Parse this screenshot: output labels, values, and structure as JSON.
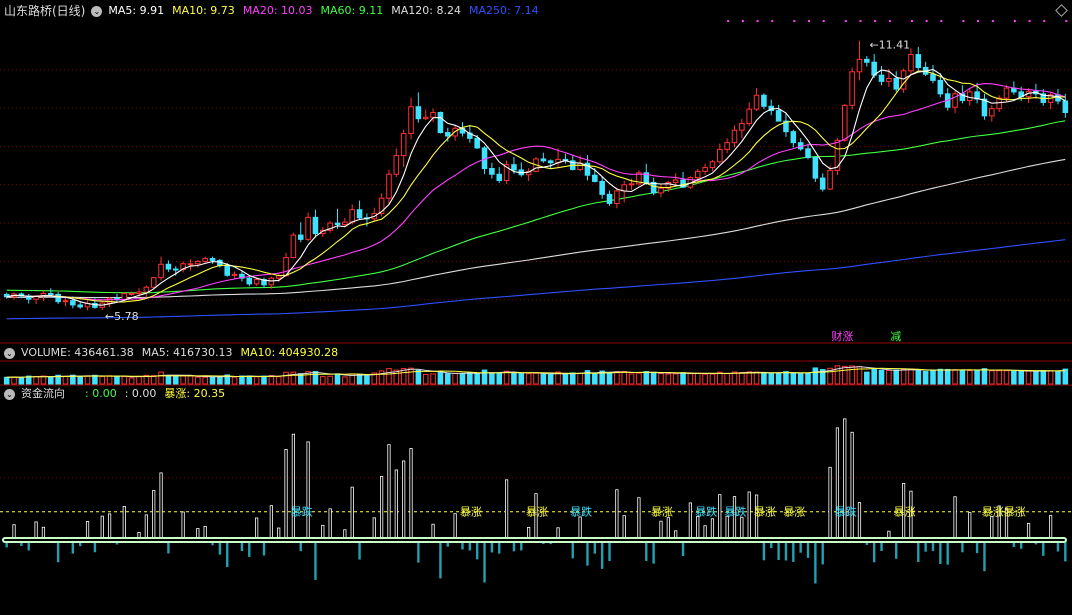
{
  "header": {
    "title": "山东路桥(日线)",
    "ma_items": [
      {
        "label": "MA5: 9.91",
        "color": "#ffffff"
      },
      {
        "label": "MA10: 9.73",
        "color": "#ffff40"
      },
      {
        "label": "MA20: 10.03",
        "color": "#ff40ff"
      },
      {
        "label": "MA60: 9.11",
        "color": "#40ff40"
      },
      {
        "label": "MA120: 8.24",
        "color": "#dddddd"
      },
      {
        "label": "MA250: 7.14",
        "color": "#3050ff"
      }
    ]
  },
  "volume_header": {
    "items": [
      {
        "label": "VOLUME: 436461.38",
        "color": "#dddddd"
      },
      {
        "label": "MA5: 416730.13",
        "color": "#dddddd"
      },
      {
        "label": "MA10: 404930.28",
        "color": "#ffff40"
      }
    ]
  },
  "flow_header": {
    "title": "资金流向",
    "items": [
      {
        "label": ": 0.00",
        "color": "#40ff40"
      },
      {
        "label": ": 0.00",
        "color": "#dddddd"
      },
      {
        "label": "暴涨: 20.35",
        "color": "#ffff40"
      }
    ]
  },
  "colors": {
    "up": "#ff3030",
    "down": "#40e0ff",
    "ma5": "#ffffff",
    "ma10": "#ffff40",
    "ma20": "#ff40ff",
    "ma60": "#40ff40",
    "ma120": "#dddddd",
    "ma250": "#3050ff",
    "grid": "#800000",
    "dot": "#ff40ff",
    "flow_down": "#20a0b0",
    "bao_zhang": "#ffff40",
    "bao_die": "#40e0ff"
  },
  "chart_data": [
    {
      "type": "candlestick",
      "ylim": [
        5.2,
        11.8
      ],
      "annotations": [
        {
          "text": "11.41",
          "index": 116,
          "value": 11.41
        },
        {
          "text": "5.78",
          "index": 12,
          "value": 5.78
        }
      ],
      "signals": [
        {
          "text": "财涨",
          "index": 113,
          "color": "#ff40ff"
        },
        {
          "text": "减",
          "index": 121,
          "color": "#40ff40"
        }
      ],
      "candles": [
        [
          6.11,
          6.15,
          6.02,
          6.06
        ],
        [
          6.06,
          6.15,
          6.0,
          6.12
        ],
        [
          6.12,
          6.15,
          6.03,
          6.08
        ],
        [
          6.08,
          6.12,
          5.92,
          6.01
        ],
        [
          6.01,
          6.09,
          5.91,
          6.08
        ],
        [
          6.08,
          6.18,
          5.97,
          6.13
        ],
        [
          6.13,
          6.24,
          6.1,
          6.11
        ],
        [
          6.11,
          6.16,
          5.91,
          5.96
        ],
        [
          5.96,
          6.05,
          5.86,
          5.98
        ],
        [
          5.98,
          6.07,
          5.82,
          5.89
        ],
        [
          5.89,
          5.96,
          5.81,
          5.85
        ],
        [
          5.85,
          5.99,
          5.78,
          5.92
        ],
        [
          5.92,
          6.05,
          5.81,
          5.84
        ],
        [
          5.84,
          5.96,
          5.79,
          5.93
        ],
        [
          5.93,
          6.06,
          5.84,
          6.03
        ],
        [
          6.03,
          6.12,
          5.95,
          6.0
        ],
        [
          6.0,
          6.15,
          5.97,
          6.13
        ],
        [
          6.13,
          6.17,
          6.08,
          6.13
        ],
        [
          6.13,
          6.24,
          6.05,
          6.16
        ],
        [
          6.16,
          6.3,
          6.05,
          6.26
        ],
        [
          6.26,
          6.48,
          6.24,
          6.46
        ],
        [
          6.46,
          6.9,
          6.4,
          6.74
        ],
        [
          6.74,
          6.82,
          6.58,
          6.64
        ],
        [
          6.64,
          6.7,
          6.5,
          6.63
        ],
        [
          6.63,
          6.8,
          6.57,
          6.75
        ],
        [
          6.75,
          6.84,
          6.61,
          6.75
        ],
        [
          6.75,
          6.83,
          6.67,
          6.8
        ],
        [
          6.8,
          6.9,
          6.75,
          6.86
        ],
        [
          6.86,
          6.9,
          6.75,
          6.82
        ],
        [
          6.82,
          6.85,
          6.67,
          6.71
        ],
        [
          6.71,
          6.77,
          6.48,
          6.51
        ],
        [
          6.51,
          6.59,
          6.44,
          6.53
        ],
        [
          6.53,
          6.6,
          6.38,
          6.45
        ],
        [
          6.45,
          6.5,
          6.28,
          6.33
        ],
        [
          6.33,
          6.46,
          6.29,
          6.42
        ],
        [
          6.42,
          6.46,
          6.25,
          6.31
        ],
        [
          6.31,
          6.48,
          6.23,
          6.45
        ],
        [
          6.45,
          6.55,
          6.37,
          6.5
        ],
        [
          6.5,
          6.98,
          6.48,
          6.88
        ],
        [
          6.88,
          7.4,
          6.86,
          7.35
        ],
        [
          7.35,
          7.62,
          7.2,
          7.26
        ],
        [
          7.26,
          7.82,
          7.22,
          7.72
        ],
        [
          7.72,
          7.88,
          7.3,
          7.38
        ],
        [
          7.38,
          7.52,
          7.31,
          7.45
        ],
        [
          7.45,
          7.64,
          7.4,
          7.6
        ],
        [
          7.6,
          7.9,
          7.48,
          7.57
        ],
        [
          7.57,
          7.71,
          7.52,
          7.62
        ],
        [
          7.62,
          7.99,
          7.57,
          7.88
        ],
        [
          7.88,
          8.07,
          7.67,
          7.71
        ],
        [
          7.71,
          7.8,
          7.53,
          7.69
        ],
        [
          7.69,
          7.92,
          7.62,
          7.8
        ],
        [
          7.8,
          8.22,
          7.74,
          8.12
        ],
        [
          8.12,
          8.71,
          8.0,
          8.62
        ],
        [
          8.62,
          9.16,
          8.56,
          9.01
        ],
        [
          9.01,
          9.55,
          8.77,
          9.47
        ],
        [
          9.47,
          10.22,
          9.35,
          10.03
        ],
        [
          10.03,
          10.33,
          9.7,
          9.78
        ],
        [
          9.78,
          9.97,
          9.75,
          9.81
        ],
        [
          9.81,
          9.99,
          9.71,
          9.91
        ],
        [
          9.91,
          9.93,
          9.47,
          9.49
        ],
        [
          9.49,
          9.59,
          9.3,
          9.42
        ],
        [
          9.42,
          9.65,
          9.32,
          9.58
        ],
        [
          9.58,
          9.71,
          9.41,
          9.48
        ],
        [
          9.48,
          9.65,
          9.28,
          9.37
        ],
        [
          9.37,
          9.44,
          9.15,
          9.17
        ],
        [
          9.17,
          9.21,
          8.62,
          8.74
        ],
        [
          8.74,
          8.86,
          8.53,
          8.62
        ],
        [
          8.62,
          8.77,
          8.44,
          8.49
        ],
        [
          8.49,
          8.91,
          8.42,
          8.82
        ],
        [
          8.82,
          8.98,
          8.63,
          8.71
        ],
        [
          8.71,
          8.87,
          8.57,
          8.61
        ],
        [
          8.61,
          8.75,
          8.48,
          8.68
        ],
        [
          8.68,
          8.98,
          8.66,
          8.94
        ],
        [
          8.94,
          9.07,
          8.86,
          8.9
        ],
        [
          8.9,
          8.93,
          8.73,
          8.86
        ],
        [
          8.86,
          9.17,
          8.75,
          8.93
        ],
        [
          8.93,
          9.05,
          8.84,
          8.9
        ],
        [
          8.9,
          9.03,
          8.7,
          8.72
        ],
        [
          8.72,
          9.01,
          8.68,
          8.85
        ],
        [
          8.85,
          9.02,
          8.49,
          8.6
        ],
        [
          8.6,
          8.75,
          8.45,
          8.47
        ],
        [
          8.47,
          8.58,
          8.11,
          8.2
        ],
        [
          8.2,
          8.28,
          7.96,
          8.01
        ],
        [
          8.01,
          8.34,
          7.91,
          8.27
        ],
        [
          8.27,
          8.48,
          8.03,
          8.4
        ],
        [
          8.4,
          8.53,
          8.29,
          8.42
        ],
        [
          8.42,
          8.7,
          8.38,
          8.65
        ],
        [
          8.65,
          8.84,
          8.4,
          8.45
        ],
        [
          8.45,
          8.55,
          8.18,
          8.23
        ],
        [
          8.23,
          8.41,
          8.14,
          8.33
        ],
        [
          8.33,
          8.48,
          8.25,
          8.45
        ],
        [
          8.45,
          8.64,
          8.39,
          8.5
        ],
        [
          8.5,
          8.67,
          8.33,
          8.35
        ],
        [
          8.35,
          8.58,
          8.31,
          8.55
        ],
        [
          8.55,
          8.73,
          8.42,
          8.68
        ],
        [
          8.68,
          8.84,
          8.61,
          8.76
        ],
        [
          8.76,
          8.92,
          8.68,
          8.88
        ],
        [
          8.88,
          9.26,
          8.84,
          9.14
        ],
        [
          9.14,
          9.37,
          9.06,
          9.28
        ],
        [
          9.28,
          9.64,
          9.18,
          9.54
        ],
        [
          9.54,
          9.78,
          9.37,
          9.68
        ],
        [
          9.68,
          10.12,
          9.63,
          9.98
        ],
        [
          9.98,
          10.42,
          9.94,
          10.27
        ],
        [
          10.27,
          10.31,
          9.98,
          10.04
        ],
        [
          10.04,
          10.18,
          9.85,
          9.95
        ],
        [
          9.95,
          10.07,
          9.72,
          9.73
        ],
        [
          9.73,
          9.89,
          9.4,
          9.51
        ],
        [
          9.51,
          9.55,
          9.18,
          9.28
        ],
        [
          9.28,
          9.37,
          9.11,
          9.15
        ],
        [
          9.15,
          9.26,
          8.93,
          8.97
        ],
        [
          8.97,
          8.99,
          8.46,
          8.54
        ],
        [
          8.54,
          8.64,
          8.26,
          8.31
        ],
        [
          8.31,
          8.8,
          8.29,
          8.7
        ],
        [
          8.7,
          9.38,
          8.6,
          9.33
        ],
        [
          9.33,
          10.09,
          9.3,
          10.06
        ],
        [
          10.06,
          10.85,
          9.97,
          10.76
        ],
        [
          10.76,
          11.41,
          10.58,
          11.02
        ],
        [
          11.02,
          11.09,
          10.87,
          10.96
        ],
        [
          10.96,
          11.13,
          10.63,
          10.69
        ],
        [
          10.69,
          10.88,
          10.48,
          10.56
        ],
        [
          10.56,
          10.82,
          10.44,
          10.62
        ],
        [
          10.62,
          10.77,
          10.34,
          10.4
        ],
        [
          10.4,
          10.83,
          10.32,
          10.78
        ],
        [
          10.78,
          11.25,
          10.69,
          11.12
        ],
        [
          11.12,
          11.28,
          10.79,
          10.85
        ],
        [
          10.85,
          10.97,
          10.67,
          10.71
        ],
        [
          10.71,
          10.9,
          10.52,
          10.58
        ],
        [
          10.58,
          10.73,
          10.23,
          10.3
        ],
        [
          10.3,
          10.42,
          9.95,
          10.02
        ],
        [
          10.02,
          10.36,
          9.9,
          10.3
        ],
        [
          10.3,
          10.48,
          10.1,
          10.16
        ],
        [
          10.16,
          10.42,
          10.05,
          10.34
        ],
        [
          10.34,
          10.53,
          10.1,
          10.19
        ],
        [
          10.19,
          10.3,
          9.76,
          9.84
        ],
        [
          9.84,
          10.06,
          9.72,
          9.99
        ],
        [
          9.99,
          10.27,
          9.92,
          10.21
        ],
        [
          10.21,
          10.48,
          10.12,
          10.42
        ],
        [
          10.42,
          10.56,
          10.28,
          10.34
        ],
        [
          10.34,
          10.45,
          10.15,
          10.24
        ],
        [
          10.24,
          10.42,
          10.11,
          10.35
        ],
        [
          10.35,
          10.51,
          10.2,
          10.3
        ],
        [
          10.3,
          10.4,
          10.05,
          10.12
        ],
        [
          10.12,
          10.32,
          9.98,
          10.28
        ],
        [
          10.28,
          10.4,
          10.08,
          10.15
        ],
        [
          10.15,
          10.3,
          9.8,
          9.91
        ]
      ]
    },
    {
      "type": "bar",
      "title": "VOLUME",
      "ylim": [
        0,
        1
      ]
    },
    {
      "type": "bar",
      "title": "资金流向",
      "ylim": [
        -12,
        20.35
      ],
      "threshold": 4.2,
      "labels": [
        {
          "text": "暴跌",
          "index": 40,
          "kind": "die"
        },
        {
          "text": "暴涨",
          "index": 63,
          "kind": "zhang"
        },
        {
          "text": "暴涨",
          "index": 72,
          "kind": "zhang"
        },
        {
          "text": "暴跌",
          "index": 78,
          "kind": "die"
        },
        {
          "text": "暴涨",
          "index": 89,
          "kind": "zhang"
        },
        {
          "text": "暴跌",
          "index": 95,
          "kind": "die"
        },
        {
          "text": "暴跌",
          "index": 99,
          "kind": "die"
        },
        {
          "text": "暴涨",
          "index": 103,
          "kind": "zhang"
        },
        {
          "text": "暴涨",
          "index": 107,
          "kind": "zhang"
        },
        {
          "text": "暴跌",
          "index": 114,
          "kind": "die"
        },
        {
          "text": "暴涨",
          "index": 122,
          "kind": "zhang"
        },
        {
          "text": "暴涨",
          "index": 134,
          "kind": "zhang"
        },
        {
          "text": "暴涨",
          "index": 137,
          "kind": "zhang"
        },
        {
          "text": "暴涨",
          "index": 152,
          "kind": "zhang"
        },
        {
          "text": "暴涨",
          "index": 160,
          "kind": "zhang"
        },
        {
          "text": "暴涨",
          "index": 168,
          "kind": "zhang"
        }
      ]
    }
  ]
}
